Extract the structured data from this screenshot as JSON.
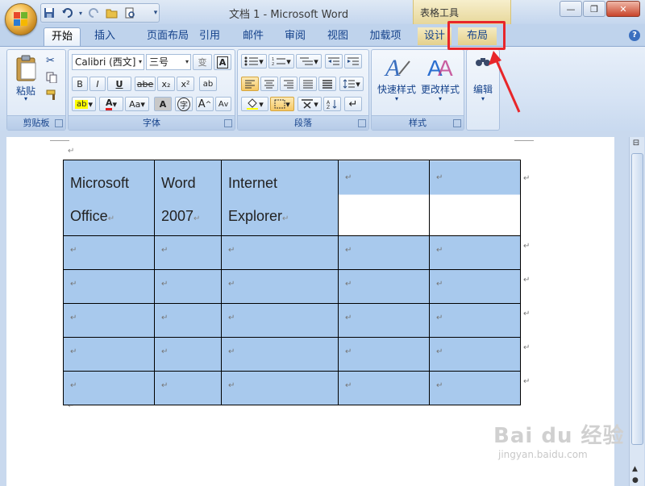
{
  "window": {
    "title": "文档 1 - Microsoft Word",
    "context_tab_title": "表格工具",
    "buttons": [
      "—",
      "❐",
      "✕"
    ]
  },
  "qat": {
    "items": [
      "save-icon",
      "undo-icon",
      "redo-icon",
      "open-icon",
      "print-preview-icon",
      "customize-icon"
    ]
  },
  "tabs": [
    {
      "label": "开始",
      "active": true
    },
    {
      "label": "插入"
    },
    {
      "label": "页面布局"
    },
    {
      "label": "引用"
    },
    {
      "label": "邮件"
    },
    {
      "label": "审阅"
    },
    {
      "label": "视图"
    },
    {
      "label": "加载项"
    },
    {
      "label": "设计"
    },
    {
      "label": "布局",
      "highlighted": true
    }
  ],
  "ribbon": {
    "clipboard": {
      "label": "剪贴板",
      "paste": "粘贴"
    },
    "font": {
      "label": "字体",
      "font_name": "Calibri (西文]",
      "font_size": "三号",
      "bold": "B",
      "italic": "I",
      "underline": "U",
      "strike": "abe",
      "subscript": "x₂",
      "superscript": "x²",
      "grow": "A",
      "shrink": "A",
      "change_case": "Aa"
    },
    "paragraph": {
      "label": "段落"
    },
    "styles": {
      "label": "样式",
      "quick_styles": "快速样式",
      "change_styles": "更改样式"
    },
    "editing": {
      "label": "编辑"
    }
  },
  "document": {
    "para_mark": "↵",
    "table": [
      [
        "Microsoft Office",
        "Word 2007",
        "Internet Explorer",
        "",
        ""
      ],
      [
        "",
        "",
        "",
        "",
        ""
      ],
      [
        "",
        "",
        "",
        "",
        ""
      ],
      [
        "",
        "",
        "",
        "",
        ""
      ],
      [
        "",
        "",
        "",
        "",
        ""
      ],
      [
        "",
        "",
        "",
        "",
        ""
      ]
    ],
    "cells": {
      "r0c0a": "Microsoft",
      "r0c0b": "Office",
      "r0c1a": "Word",
      "r0c1b": "2007",
      "r0c2a": "Internet",
      "r0c2b": "Explorer"
    }
  },
  "watermark": {
    "brand": "Bai du 经验",
    "url": "jingyan.baidu.com"
  },
  "colors": {
    "highlight": "#a8c9ed",
    "annotation": "#e8262a",
    "ribbon": "#d6e3f4"
  }
}
